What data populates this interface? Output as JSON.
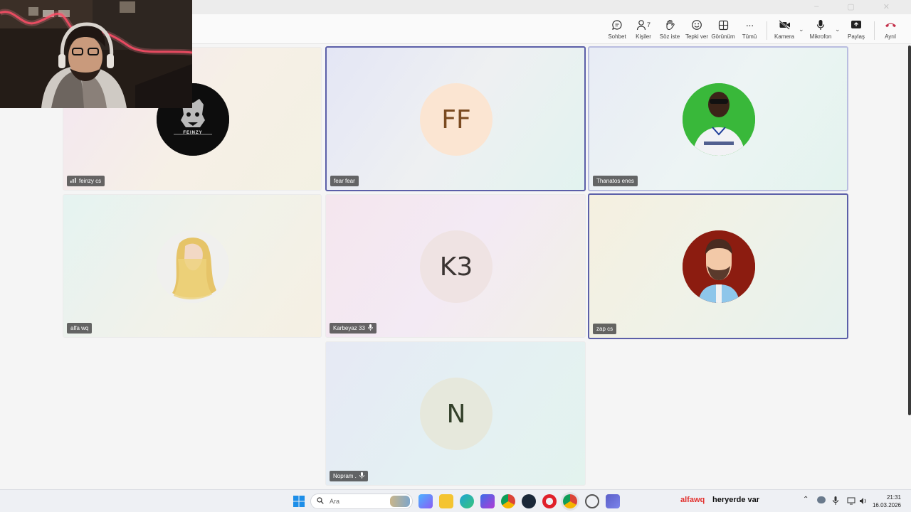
{
  "toolbar": {
    "buttons": [
      {
        "label": "Sohbet",
        "icon": "chat-icon"
      },
      {
        "label": "Kişiler",
        "icon": "people-icon",
        "count": "7"
      },
      {
        "label": "Söz iste",
        "icon": "raise-hand-icon"
      },
      {
        "label": "Tepki ver",
        "icon": "smiley-icon"
      },
      {
        "label": "Görünüm",
        "icon": "grid-icon"
      },
      {
        "label": "Tümü",
        "icon": "more-icon",
        "glyph": "···"
      },
      {
        "label": "Kamera",
        "icon": "camera-off-icon"
      },
      {
        "label": "Mikrofon",
        "icon": "mic-icon"
      },
      {
        "label": "Paylaş",
        "icon": "share-icon"
      },
      {
        "label": "Ayrıl",
        "icon": "leave-icon"
      }
    ],
    "caret": "⌄"
  },
  "window": {
    "minimize": "–",
    "maximize": "▢",
    "close": "✕"
  },
  "participants": [
    {
      "name": "feinzy cs",
      "avatar_type": "logo",
      "logo_text": "FEINZY",
      "state": "signal"
    },
    {
      "name": "fear fear",
      "avatar_type": "initials",
      "initials": "FF",
      "state": "speaking"
    },
    {
      "name": "Thanatos enes",
      "avatar_type": "photo",
      "state": "speaking-light"
    },
    {
      "name": "alfa wq",
      "avatar_type": "photo",
      "state": "normal"
    },
    {
      "name": "Karbeyaz 33",
      "avatar_type": "initials",
      "initials": "K3",
      "state": "muted"
    },
    {
      "name": "zap cs",
      "avatar_type": "cartoon",
      "state": "speaking"
    },
    {
      "name": "Nopram .",
      "avatar_type": "initials",
      "initials": "N",
      "state": "muted"
    }
  ],
  "taskbar": {
    "search_placeholder": "Ara",
    "ticker_user": "alfawq",
    "ticker_message": "heryerde var",
    "time": "21:31",
    "date": "16.03.2026",
    "tray_caret": "⌃"
  },
  "colors": {
    "accent": "#5b5fa8",
    "leave": "#c4314b",
    "ticker_user": "#e2312e"
  }
}
